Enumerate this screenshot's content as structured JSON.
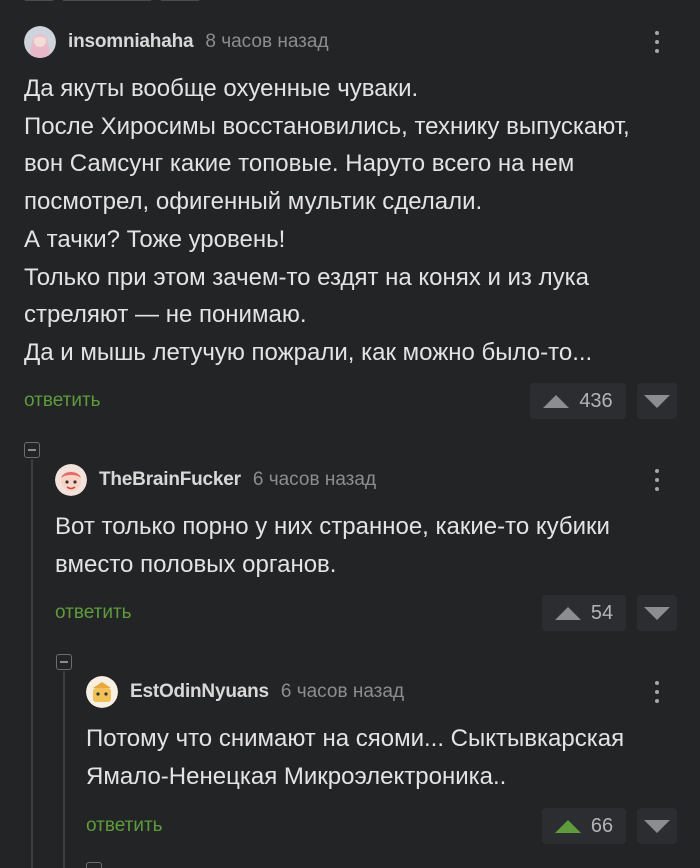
{
  "comments": [
    {
      "username": "insomniahaha",
      "time": "8 часов назад",
      "lines": [
        "Да якуты вообще охуенные чуваки.",
        "После Хиросимы восстановились, технику выпускают,",
        "вон Самсунг какие топовые. Наруто всего на нем",
        "посмотрел, офигенный мультик сделали.",
        "А тачки? Тоже уровень!",
        "Только при этом зачем-то ездят на конях и из лука",
        "стреляют — не понимаю.",
        "Да и мышь летучую пожрали, как можно было-то..."
      ],
      "reply_label": "ответить",
      "rating": "436"
    },
    {
      "username": "TheBrainFucker",
      "time": "6 часов назад",
      "lines": [
        "Вот только порно у них странное, какие-то кубики",
        "вместо половых органов."
      ],
      "reply_label": "ответить",
      "rating": "54"
    },
    {
      "username": "EstOdinNyuans",
      "time": "6 часов назад",
      "lines": [
        "Потому что снимают на сяоми... Сыктывкарская",
        "Ямало-Ненецкая Микроэлектроника.."
      ],
      "reply_label": "ответить",
      "rating": "66",
      "upvoted": true
    }
  ],
  "colors": {
    "background": "#232426",
    "reply_link": "#5d9b3c",
    "upvoted": "#5d9b3c"
  },
  "icons": [
    "collapse-thread-icon",
    "more-options-icon",
    "upvote-icon",
    "downvote-icon"
  ]
}
